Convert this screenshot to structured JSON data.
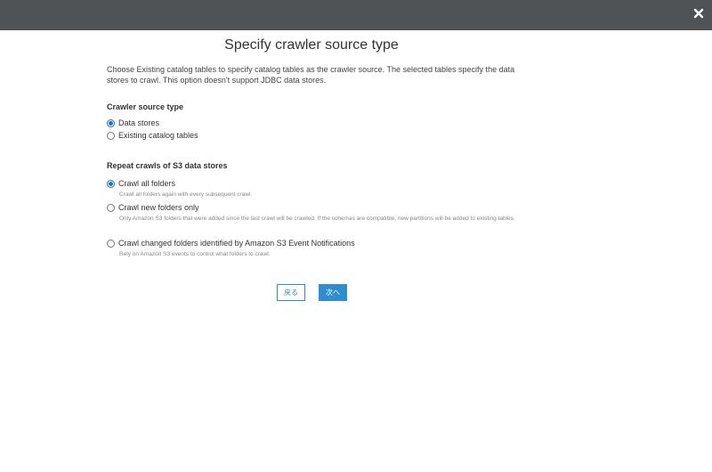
{
  "page": {
    "title": "Specify crawler source type",
    "description": "Choose Existing catalog tables to specify catalog tables as the crawler source. The selected tables specify the data stores to crawl. This option doesn't support JDBC data stores."
  },
  "crawler_source": {
    "heading": "Crawler source type",
    "options": [
      {
        "label": "Data stores",
        "selected": true
      },
      {
        "label": "Existing catalog tables",
        "selected": false
      }
    ]
  },
  "repeat_crawls": {
    "heading": "Repeat crawls of S3 data stores",
    "options": [
      {
        "label": "Crawl all folders",
        "hint": "Crawl all folders again with every subsequent crawl.",
        "selected": true
      },
      {
        "label": "Crawl new folders only",
        "hint": "Only Amazon S3 folders that were added since the last crawl will be crawled. If the schemas are compatible, new partitions will be added to existing tables.",
        "selected": false
      },
      {
        "label": "Crawl changed folders identified by Amazon S3 Event Notifications",
        "hint": "Rely on Amazon S3 events to control what folders to crawl.",
        "selected": false
      }
    ]
  },
  "buttons": {
    "back": "戻る",
    "next": "次へ"
  },
  "icons": {
    "close": "close-icon"
  },
  "colors": {
    "topbar": "#4f5356",
    "accent": "#2e8ecf",
    "radio_selected": "#1a73c8"
  }
}
